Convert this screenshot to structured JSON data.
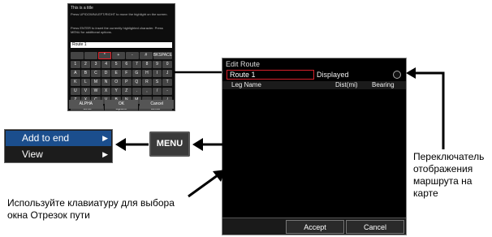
{
  "keyboard_dialog": {
    "title": "This is a title",
    "instruction1": "Press UP/DOWN/LEFT/RIGHT to move the highlight on the screen.",
    "instruction2": "Press ENTER to insert the currently highlighted character. Press MENU for additional options.",
    "entry_value": "Route 1",
    "rows": [
      [
        "",
        "",
        "*",
        "+",
        "-",
        "#",
        "BKSPACE"
      ],
      [
        "1",
        "2",
        "3",
        "4",
        "5",
        "6",
        "7",
        "8",
        "9",
        "0"
      ],
      [
        "A",
        "B",
        "C",
        "D",
        "E",
        "F",
        "G",
        "H",
        "I",
        "J"
      ],
      [
        "K",
        "L",
        "M",
        "N",
        "O",
        "P",
        "Q",
        "R",
        "S",
        "T"
      ],
      [
        "U",
        "V",
        "W",
        "X",
        "Y",
        "Z",
        ".",
        ",",
        "/",
        "-"
      ],
      [
        "Z",
        "X",
        "C",
        "V",
        "B",
        "N",
        "M",
        ",",
        ".",
        "/"
      ],
      [
        "Shift",
        "Space",
        "Clear"
      ]
    ],
    "buttons": [
      "ALPHA",
      "OK",
      "Cancel"
    ]
  },
  "edit_route": {
    "title": "Edit Route",
    "route_name": "Route 1",
    "displayed_label": "Displayed",
    "col_leg_name": "Leg Name",
    "col_dist": "Dist(mi)",
    "col_bearing": "Bearing",
    "accept_label": "Accept",
    "cancel_label": "Cancel"
  },
  "menu": {
    "items": [
      {
        "label": "Add to end",
        "icon": "chevron-right-icon",
        "selected": true
      },
      {
        "label": "View",
        "icon": "chevron-right-icon",
        "selected": false
      }
    ]
  },
  "menu_key": {
    "label": "MENU"
  },
  "captions": {
    "keyboard_hint": [
      "Используйте клавиатуру для выбора",
      "окна Отрезок пути"
    ],
    "display_toggle": [
      "Переключатель",
      "отображения",
      "маршрута на",
      "карте"
    ]
  },
  "colors": {
    "accent_red": "#d4202a",
    "menu_highlight": "#1b4e8d"
  }
}
